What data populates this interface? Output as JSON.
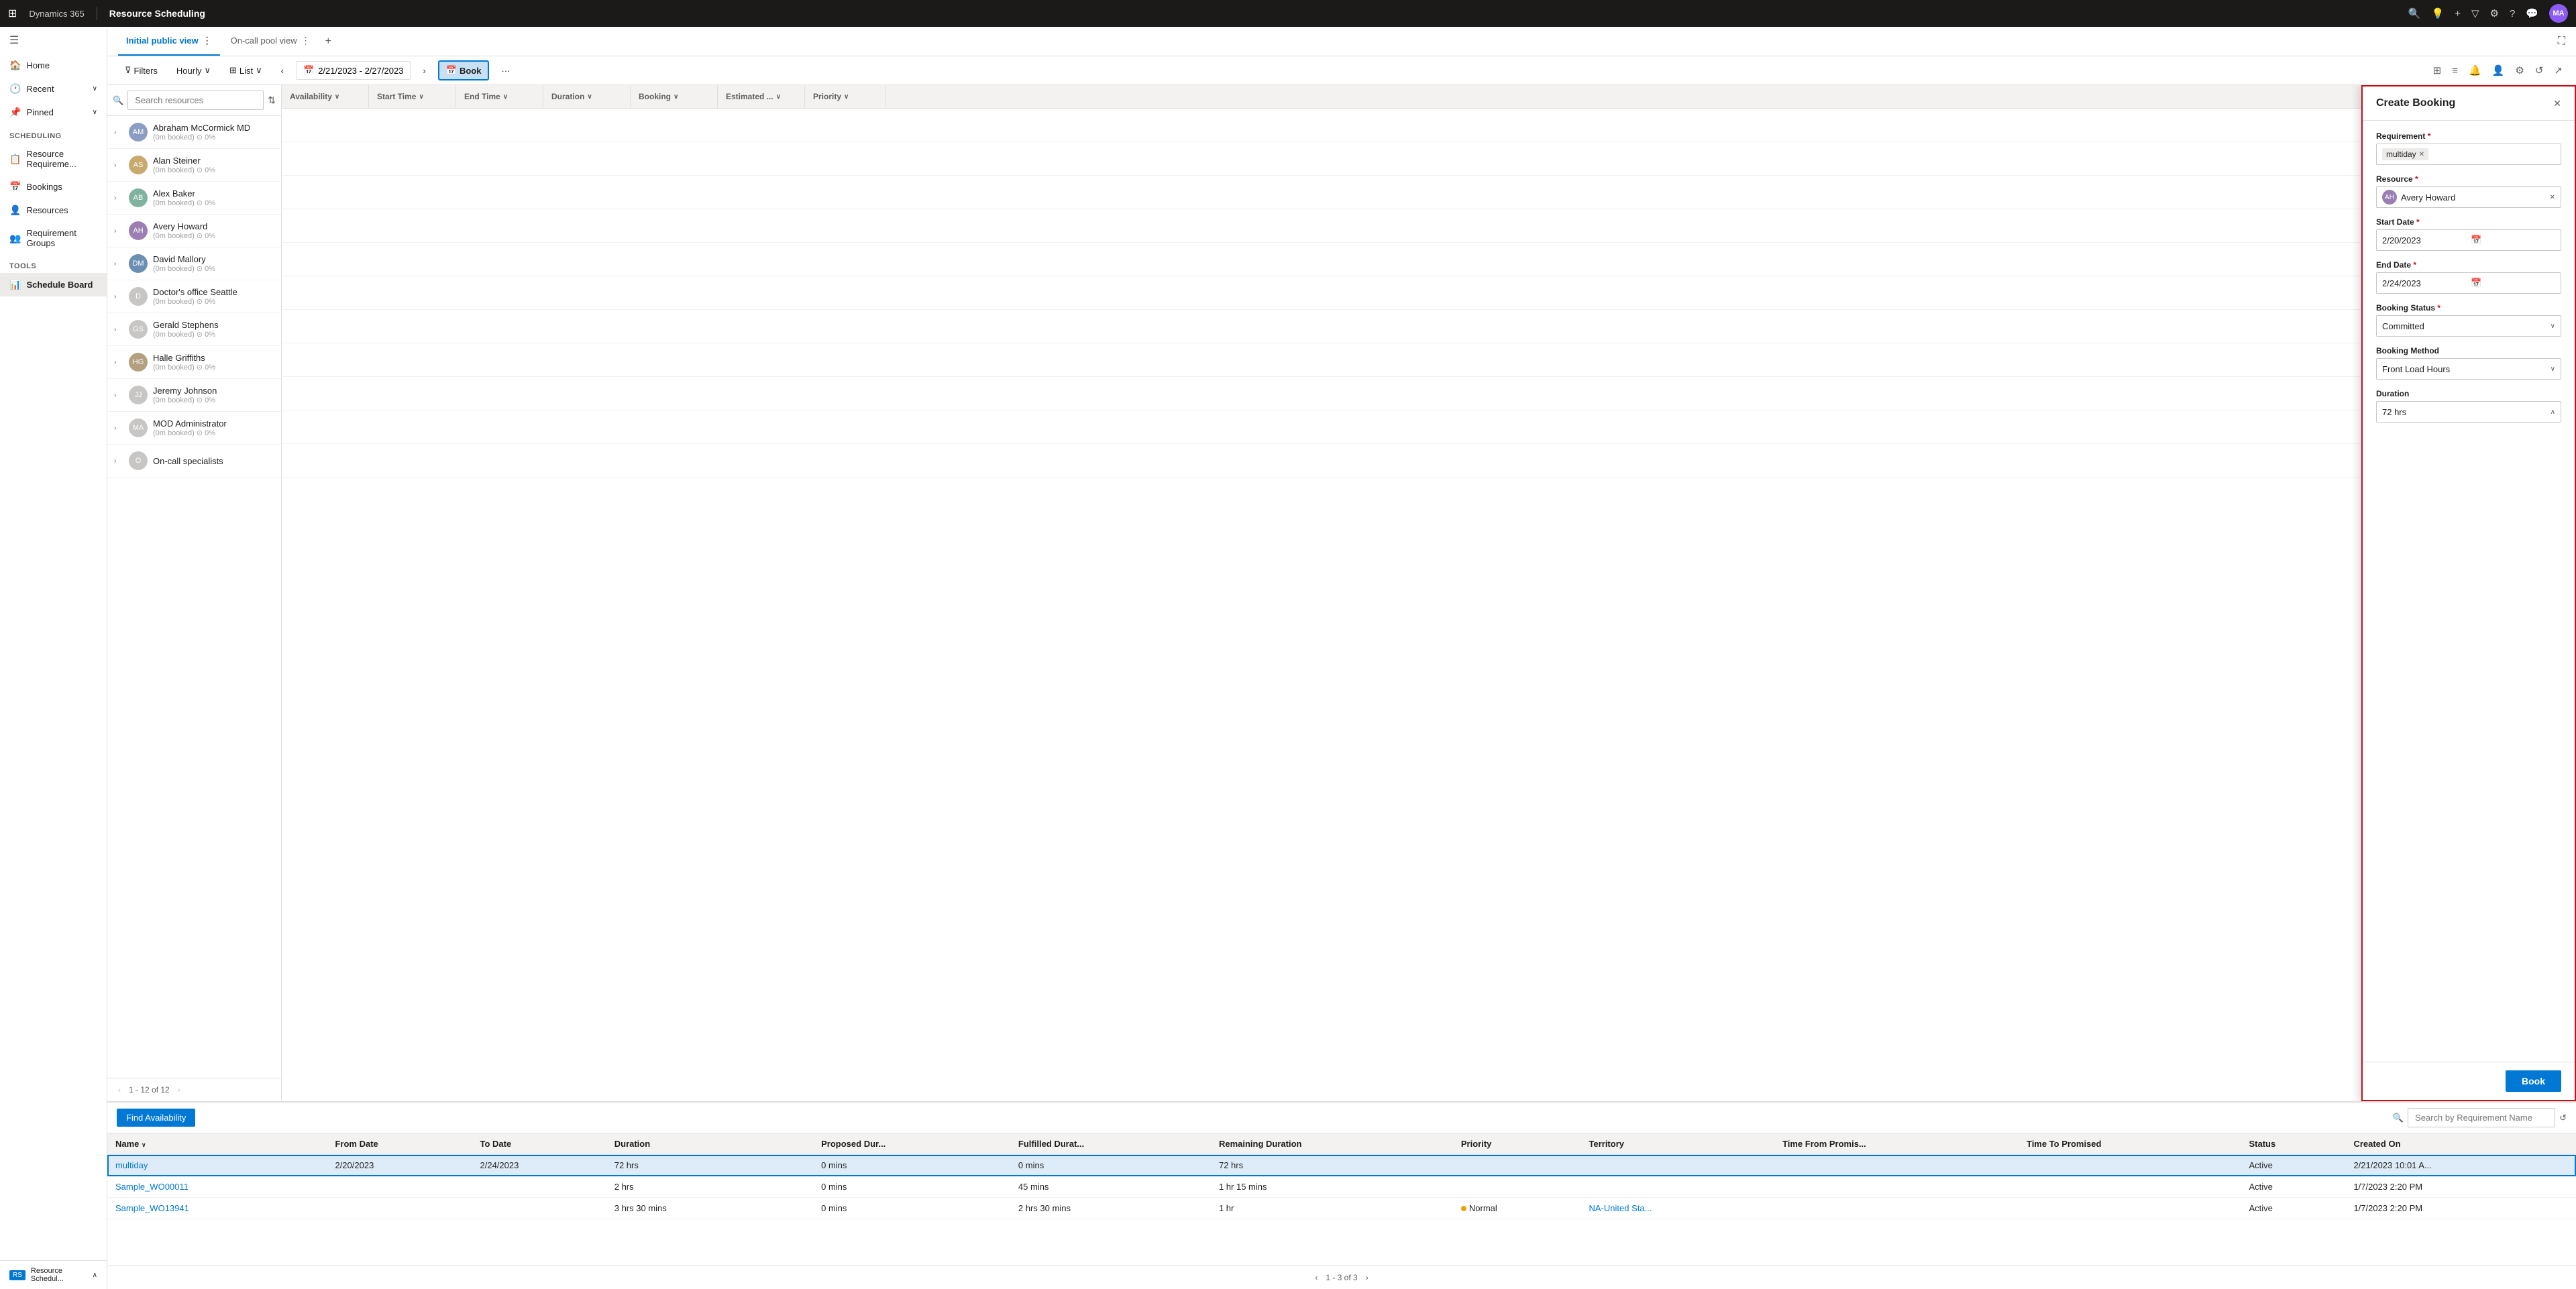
{
  "topNav": {
    "waffle": "⊞",
    "brand": "Dynamics 365",
    "separator": "|",
    "title": "Resource Scheduling",
    "icons": [
      "🔍",
      "💡",
      "+",
      "▽",
      "⚙",
      "?",
      "💬"
    ],
    "avatar": "MA"
  },
  "sidebar": {
    "hamburger": "☰",
    "navItems": [
      {
        "id": "home",
        "label": "Home",
        "icon": "🏠",
        "interactable": true
      },
      {
        "id": "recent",
        "label": "Recent",
        "icon": "🕐",
        "caret": "∨",
        "interactable": true
      },
      {
        "id": "pinned",
        "label": "Pinned",
        "icon": "📌",
        "caret": "∨",
        "interactable": true
      }
    ],
    "sections": [
      {
        "title": "Scheduling",
        "items": [
          {
            "id": "resource-req",
            "label": "Resource Requireme...",
            "icon": "📋",
            "interactable": true
          },
          {
            "id": "bookings",
            "label": "Bookings",
            "icon": "📅",
            "interactable": true
          },
          {
            "id": "resources",
            "label": "Resources",
            "icon": "👤",
            "interactable": true
          },
          {
            "id": "req-groups",
            "label": "Requirement Groups",
            "icon": "👥",
            "interactable": true
          }
        ]
      },
      {
        "title": "Tools",
        "items": [
          {
            "id": "schedule-board",
            "label": "Schedule Board",
            "icon": "📊",
            "active": true,
            "interactable": true
          }
        ]
      }
    ],
    "bottomItem": {
      "label": "Resource Schedul...",
      "icon": "RS",
      "caret": "∧"
    }
  },
  "tabs": [
    {
      "id": "initial-public",
      "label": "Initial public view",
      "active": true
    },
    {
      "id": "on-call-pool",
      "label": "On-call pool view",
      "active": false
    }
  ],
  "toolbar": {
    "filters": "Filters",
    "hourly": "Hourly",
    "list": "List",
    "prevArrow": "‹",
    "nextArrow": "›",
    "dateRange": "2/21/2023 - 2/27/2023",
    "book": "Book",
    "moreOptions": "···",
    "rightIcons": [
      "⊞",
      "≡",
      "🔔",
      "👤",
      "⚙",
      "↺",
      "↗"
    ]
  },
  "resourcePanel": {
    "searchPlaceholder": "Search resources",
    "sortIcon": "⇅",
    "columnHeaders": [
      {
        "label": "Availability",
        "sort": "∨"
      },
      {
        "label": "Start Time",
        "sort": "∨"
      },
      {
        "label": "End Time",
        "sort": "∨"
      },
      {
        "label": "Duration",
        "sort": "∨"
      },
      {
        "label": "Booking",
        "sort": "∨"
      },
      {
        "label": "Estimated ...",
        "sort": "∨"
      },
      {
        "label": "Priority",
        "sort": "∨"
      }
    ],
    "resources": [
      {
        "id": "r1",
        "name": "Abraham McCormick MD",
        "sub": "(0m booked) ⊙ 0%",
        "avatarColor": "#8b9dc3",
        "initials": "AM"
      },
      {
        "id": "r2",
        "name": "Alan Steiner",
        "sub": "(0m booked) ⊙ 0%",
        "avatarColor": "#c8a96e",
        "initials": "AS"
      },
      {
        "id": "r3",
        "name": "Alex Baker",
        "sub": "(0m booked) ⊙ 0%",
        "avatarColor": "#7fb3a0",
        "initials": "AB"
      },
      {
        "id": "r4",
        "name": "Avery Howard",
        "sub": "(0m booked) ⊙ 0%",
        "avatarColor": "#9b7fb3",
        "initials": "AH"
      },
      {
        "id": "r5",
        "name": "David Mallory",
        "sub": "(0m booked) ⊙ 0%",
        "avatarColor": "#6b8fb3",
        "initials": "DM"
      },
      {
        "id": "r6",
        "name": "Doctor's office Seattle",
        "sub": "(0m booked) ⊙ 0%",
        "avatarColor": "#c8c6c4",
        "initials": "D"
      },
      {
        "id": "r7",
        "name": "Gerald Stephens",
        "sub": "(0m booked) ⊙ 0%",
        "avatarColor": "#c8c6c4",
        "initials": "GS"
      },
      {
        "id": "r8",
        "name": "Halle Griffiths",
        "sub": "(0m booked) ⊙ 0%",
        "avatarColor": "#b3a07f",
        "initials": "HG"
      },
      {
        "id": "r9",
        "name": "Jeremy Johnson",
        "sub": "(0m booked) ⊙ 0%",
        "avatarColor": "#c8c6c4",
        "initials": "JJ"
      },
      {
        "id": "r10",
        "name": "MOD Administrator",
        "sub": "(0m booked) ⊙ 0%",
        "avatarColor": "#c8c6c4",
        "initials": "MA"
      },
      {
        "id": "r11",
        "name": "On-call specialists",
        "sub": "",
        "avatarColor": "#c8c6c4",
        "initials": "O"
      }
    ],
    "pagination": "1 - 12 of 12"
  },
  "createBooking": {
    "title": "Create Booking",
    "closeBtn": "✕",
    "fields": {
      "requirement": {
        "label": "Requirement",
        "required": true,
        "value": "multiday"
      },
      "resource": {
        "label": "Resource",
        "required": true,
        "value": "Avery Howard"
      },
      "startDate": {
        "label": "Start Date",
        "required": true,
        "value": "2/20/2023",
        "icon": "📅"
      },
      "endDate": {
        "label": "End Date",
        "required": true,
        "value": "2/24/2023",
        "icon": "📅"
      },
      "bookingStatus": {
        "label": "Booking Status",
        "required": true,
        "value": "Committed"
      },
      "bookingMethod": {
        "label": "Booking Method",
        "value": "Front Load Hours"
      },
      "duration": {
        "label": "Duration",
        "value": "72 hrs"
      }
    },
    "bookBtn": "Book"
  },
  "bottomSection": {
    "findAvailBtn": "Find Availability",
    "searchPlaceholder": "Search by Requirement Name",
    "refreshIcon": "↺",
    "tableHeaders": [
      "Name",
      "From Date",
      "To Date",
      "Duration",
      "",
      "Proposed Dur...",
      "Fulfilled Durat...",
      "Remaining Duration",
      "Priority",
      "Territory",
      "Time From Promis...",
      "Time To Promised",
      "Status",
      "Created On"
    ],
    "tableRows": [
      {
        "id": "req1",
        "name": "multiday",
        "fromDate": "2/20/2023",
        "toDate": "2/24/2023",
        "duration": "72 hrs",
        "extra": "",
        "proposedDur": "0 mins",
        "fulfilledDur": "0 mins",
        "remainingDuration": "72 hrs",
        "priority": "",
        "territory": "",
        "timeFromPromise": "",
        "timeToPromised": "",
        "status": "Active",
        "createdOn": "2/21/2023 10:01 A...",
        "selected": true
      },
      {
        "id": "req2",
        "name": "Sample_WO00011",
        "fromDate": "",
        "toDate": "",
        "duration": "2 hrs",
        "extra": "",
        "proposedDur": "0 mins",
        "fulfilledDur": "45 mins",
        "remainingDuration": "1 hr 15 mins",
        "priority": "",
        "territory": "",
        "timeFromPromise": "",
        "timeToPromised": "",
        "status": "Active",
        "createdOn": "1/7/2023 2:20 PM",
        "selected": false
      },
      {
        "id": "req3",
        "name": "Sample_WO13941",
        "fromDate": "",
        "toDate": "",
        "duration": "3 hrs 30 mins",
        "extra": "",
        "proposedDur": "0 mins",
        "fulfilledDur": "2 hrs 30 mins",
        "remainingDuration": "1 hr",
        "priority": "Normal",
        "territory": "NA-United Sta...",
        "timeFromPromise": "",
        "timeToPromised": "",
        "status": "Active",
        "createdOn": "1/7/2023 2:20 PM",
        "selected": false
      }
    ],
    "pagination": "1 - 3 of 3"
  }
}
